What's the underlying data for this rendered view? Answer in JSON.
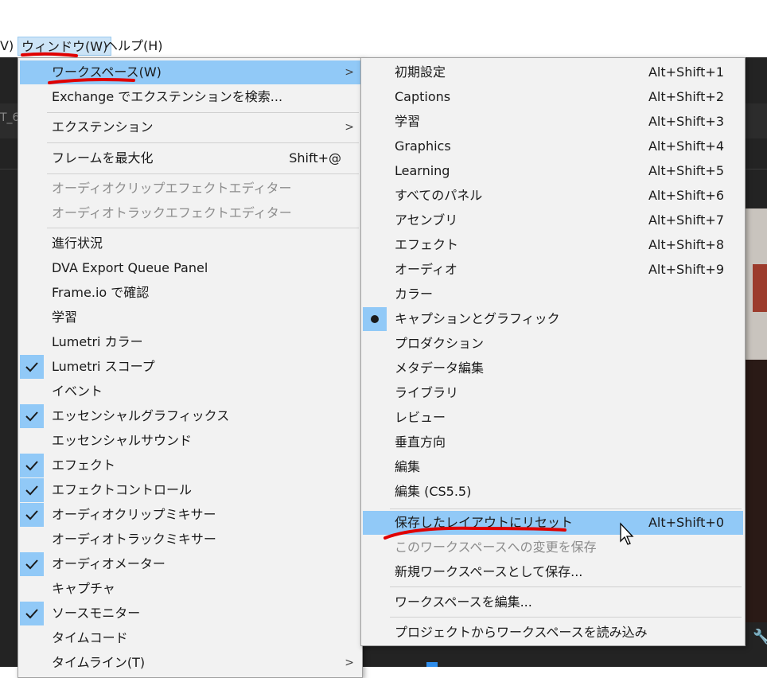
{
  "menubar": {
    "prev_item": "V)",
    "window": "ウィンドウ(W)",
    "help": "ヘルプ(H)"
  },
  "background": {
    "tab_text": "T_6"
  },
  "window_menu": {
    "workspace": "ワークスペース(W)",
    "exchange": "Exchange でエクステンションを検索...",
    "extensions": "エクステンション",
    "maximize_frame": "フレームを最大化",
    "maximize_frame_shortcut": "Shift+@",
    "audio_clip_effect_editor": "オーディオクリップエフェクトエディター",
    "audio_track_effect_editor": "オーディオトラックエフェクトエディター",
    "progress": "進行状況",
    "dva_export": "DVA Export Queue Panel",
    "frameio": "Frame.io で確認",
    "learn": "学習",
    "lumetri_color": "Lumetri カラー",
    "lumetri_scopes": "Lumetri スコープ",
    "events": "イベント",
    "essential_graphics": "エッセンシャルグラフィックス",
    "essential_sound": "エッセンシャルサウンド",
    "effects": "エフェクト",
    "effect_controls": "エフェクトコントロール",
    "audio_clip_mixer": "オーディオクリップミキサー",
    "audio_track_mixer": "オーディオトラックミキサー",
    "audio_meters": "オーディオメーター",
    "capture": "キャプチャ",
    "source_monitor": "ソースモニター",
    "timecode": "タイムコード",
    "timeline": "タイムライン(T)"
  },
  "workspace_menu": {
    "items": [
      {
        "label": "初期設定",
        "shortcut": "Alt+Shift+1"
      },
      {
        "label": "Captions",
        "shortcut": "Alt+Shift+2"
      },
      {
        "label": "学習",
        "shortcut": "Alt+Shift+3"
      },
      {
        "label": "Graphics",
        "shortcut": "Alt+Shift+4"
      },
      {
        "label": "Learning",
        "shortcut": "Alt+Shift+5"
      },
      {
        "label": "すべてのパネル",
        "shortcut": "Alt+Shift+6"
      },
      {
        "label": "アセンブリ",
        "shortcut": "Alt+Shift+7"
      },
      {
        "label": "エフェクト",
        "shortcut": "Alt+Shift+8"
      },
      {
        "label": "オーディオ",
        "shortcut": "Alt+Shift+9"
      },
      {
        "label": "カラー",
        "shortcut": ""
      },
      {
        "label": "キャプションとグラフィック",
        "shortcut": ""
      },
      {
        "label": "プロダクション",
        "shortcut": ""
      },
      {
        "label": "メタデータ編集",
        "shortcut": ""
      },
      {
        "label": "ライブラリ",
        "shortcut": ""
      },
      {
        "label": "レビュー",
        "shortcut": ""
      },
      {
        "label": "垂直方向",
        "shortcut": ""
      },
      {
        "label": "編集",
        "shortcut": ""
      },
      {
        "label": "編集 (CS5.5)",
        "shortcut": ""
      }
    ],
    "reset_layout": "保存したレイアウトにリセット",
    "reset_layout_shortcut": "Alt+Shift+0",
    "save_changes": "このワークスペースへの変更を保存",
    "save_as_new": "新規ワークスペースとして保存...",
    "edit_workspaces": "ワークスペースを編集...",
    "import_from_project": "プロジェクトからワークスペースを読み込み"
  },
  "colors": {
    "highlight": "#91c9f7",
    "annotation": "#e00000"
  }
}
